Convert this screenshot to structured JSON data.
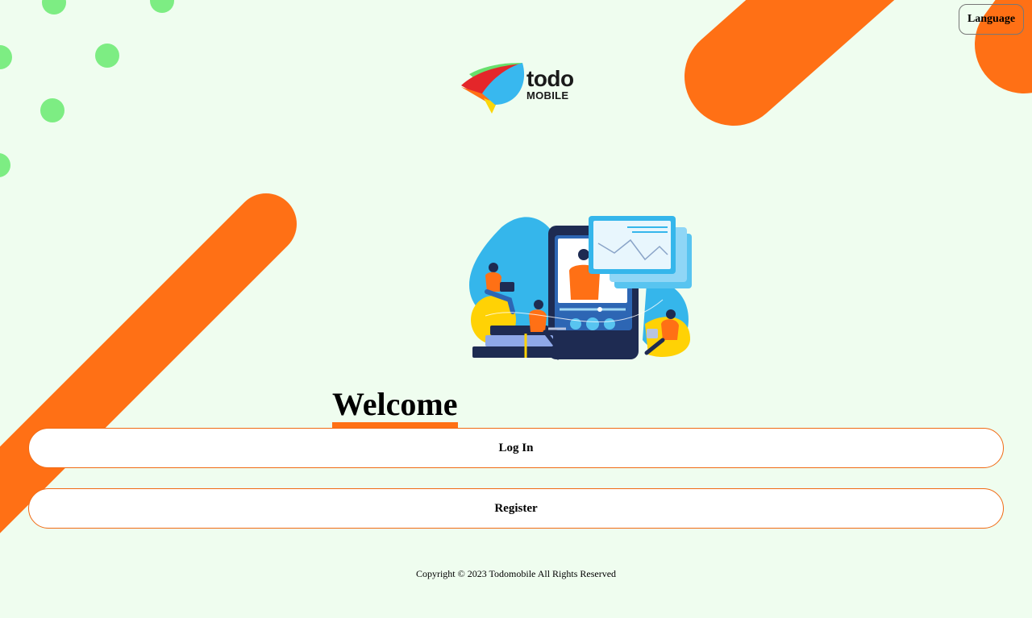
{
  "header": {
    "language_label": "Language"
  },
  "logo": {
    "word": "todo",
    "sub": "MOBILE"
  },
  "main": {
    "welcome": "Welcome",
    "login_label": "Log In",
    "register_label": "Register"
  },
  "footer": {
    "copyright": "Copyright © 2023 Todomobile All Rights Reserved"
  },
  "colors": {
    "background": "#effdef",
    "accent_orange": "#ff7015",
    "dot_green": "#7ded83",
    "button_border": "#f06a14"
  },
  "icons": {
    "logo": "todo-mobile-logo",
    "illustration": "online-learning-illustration"
  }
}
